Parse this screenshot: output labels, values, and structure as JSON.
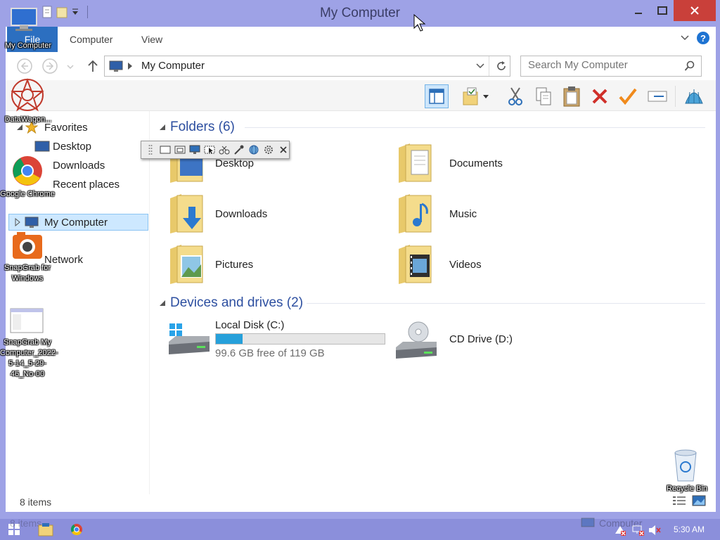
{
  "window": {
    "title": "My Computer",
    "tabs": {
      "file": "File",
      "computer": "Computer",
      "view": "View"
    }
  },
  "address": {
    "path": "My Computer"
  },
  "search": {
    "placeholder": "Search My Computer"
  },
  "navigation": {
    "favorites": "Favorites",
    "desktop": "Desktop",
    "downloads": "Downloads",
    "recent": "Recent places",
    "computer": "My Computer",
    "network": "Network"
  },
  "folders": {
    "header": "Folders (6)",
    "items": [
      "Desktop",
      "Downloads",
      "Pictures",
      "Documents",
      "Music",
      "Videos"
    ]
  },
  "drives": {
    "header": "Devices and drives (2)",
    "local": {
      "name": "Local Disk (C:)",
      "free": "99.6 GB free of 119 GB",
      "used_fraction": 0.16
    },
    "cd": {
      "name": "CD Drive (D:)"
    }
  },
  "status": {
    "items": "8 items"
  },
  "desktop": {
    "my_computer": "My Computer",
    "datawagon": "DataWagon...",
    "chrome": "Google Chrome",
    "snapgrab": "SnapGrab for Windows",
    "snapfile": "SnapGrab My Computer_2022-5-14_5-29-46_No-00",
    "recycle": "Recycle Bin"
  },
  "taskbar": {
    "time": "5:30 AM",
    "ghost_items": "8 items",
    "ghost_computer": "Computer"
  },
  "colors": {
    "accent": "#2c6fc0",
    "frame": "#9ea2e6",
    "close": "#c9403a",
    "selection": "#cde8ff"
  }
}
